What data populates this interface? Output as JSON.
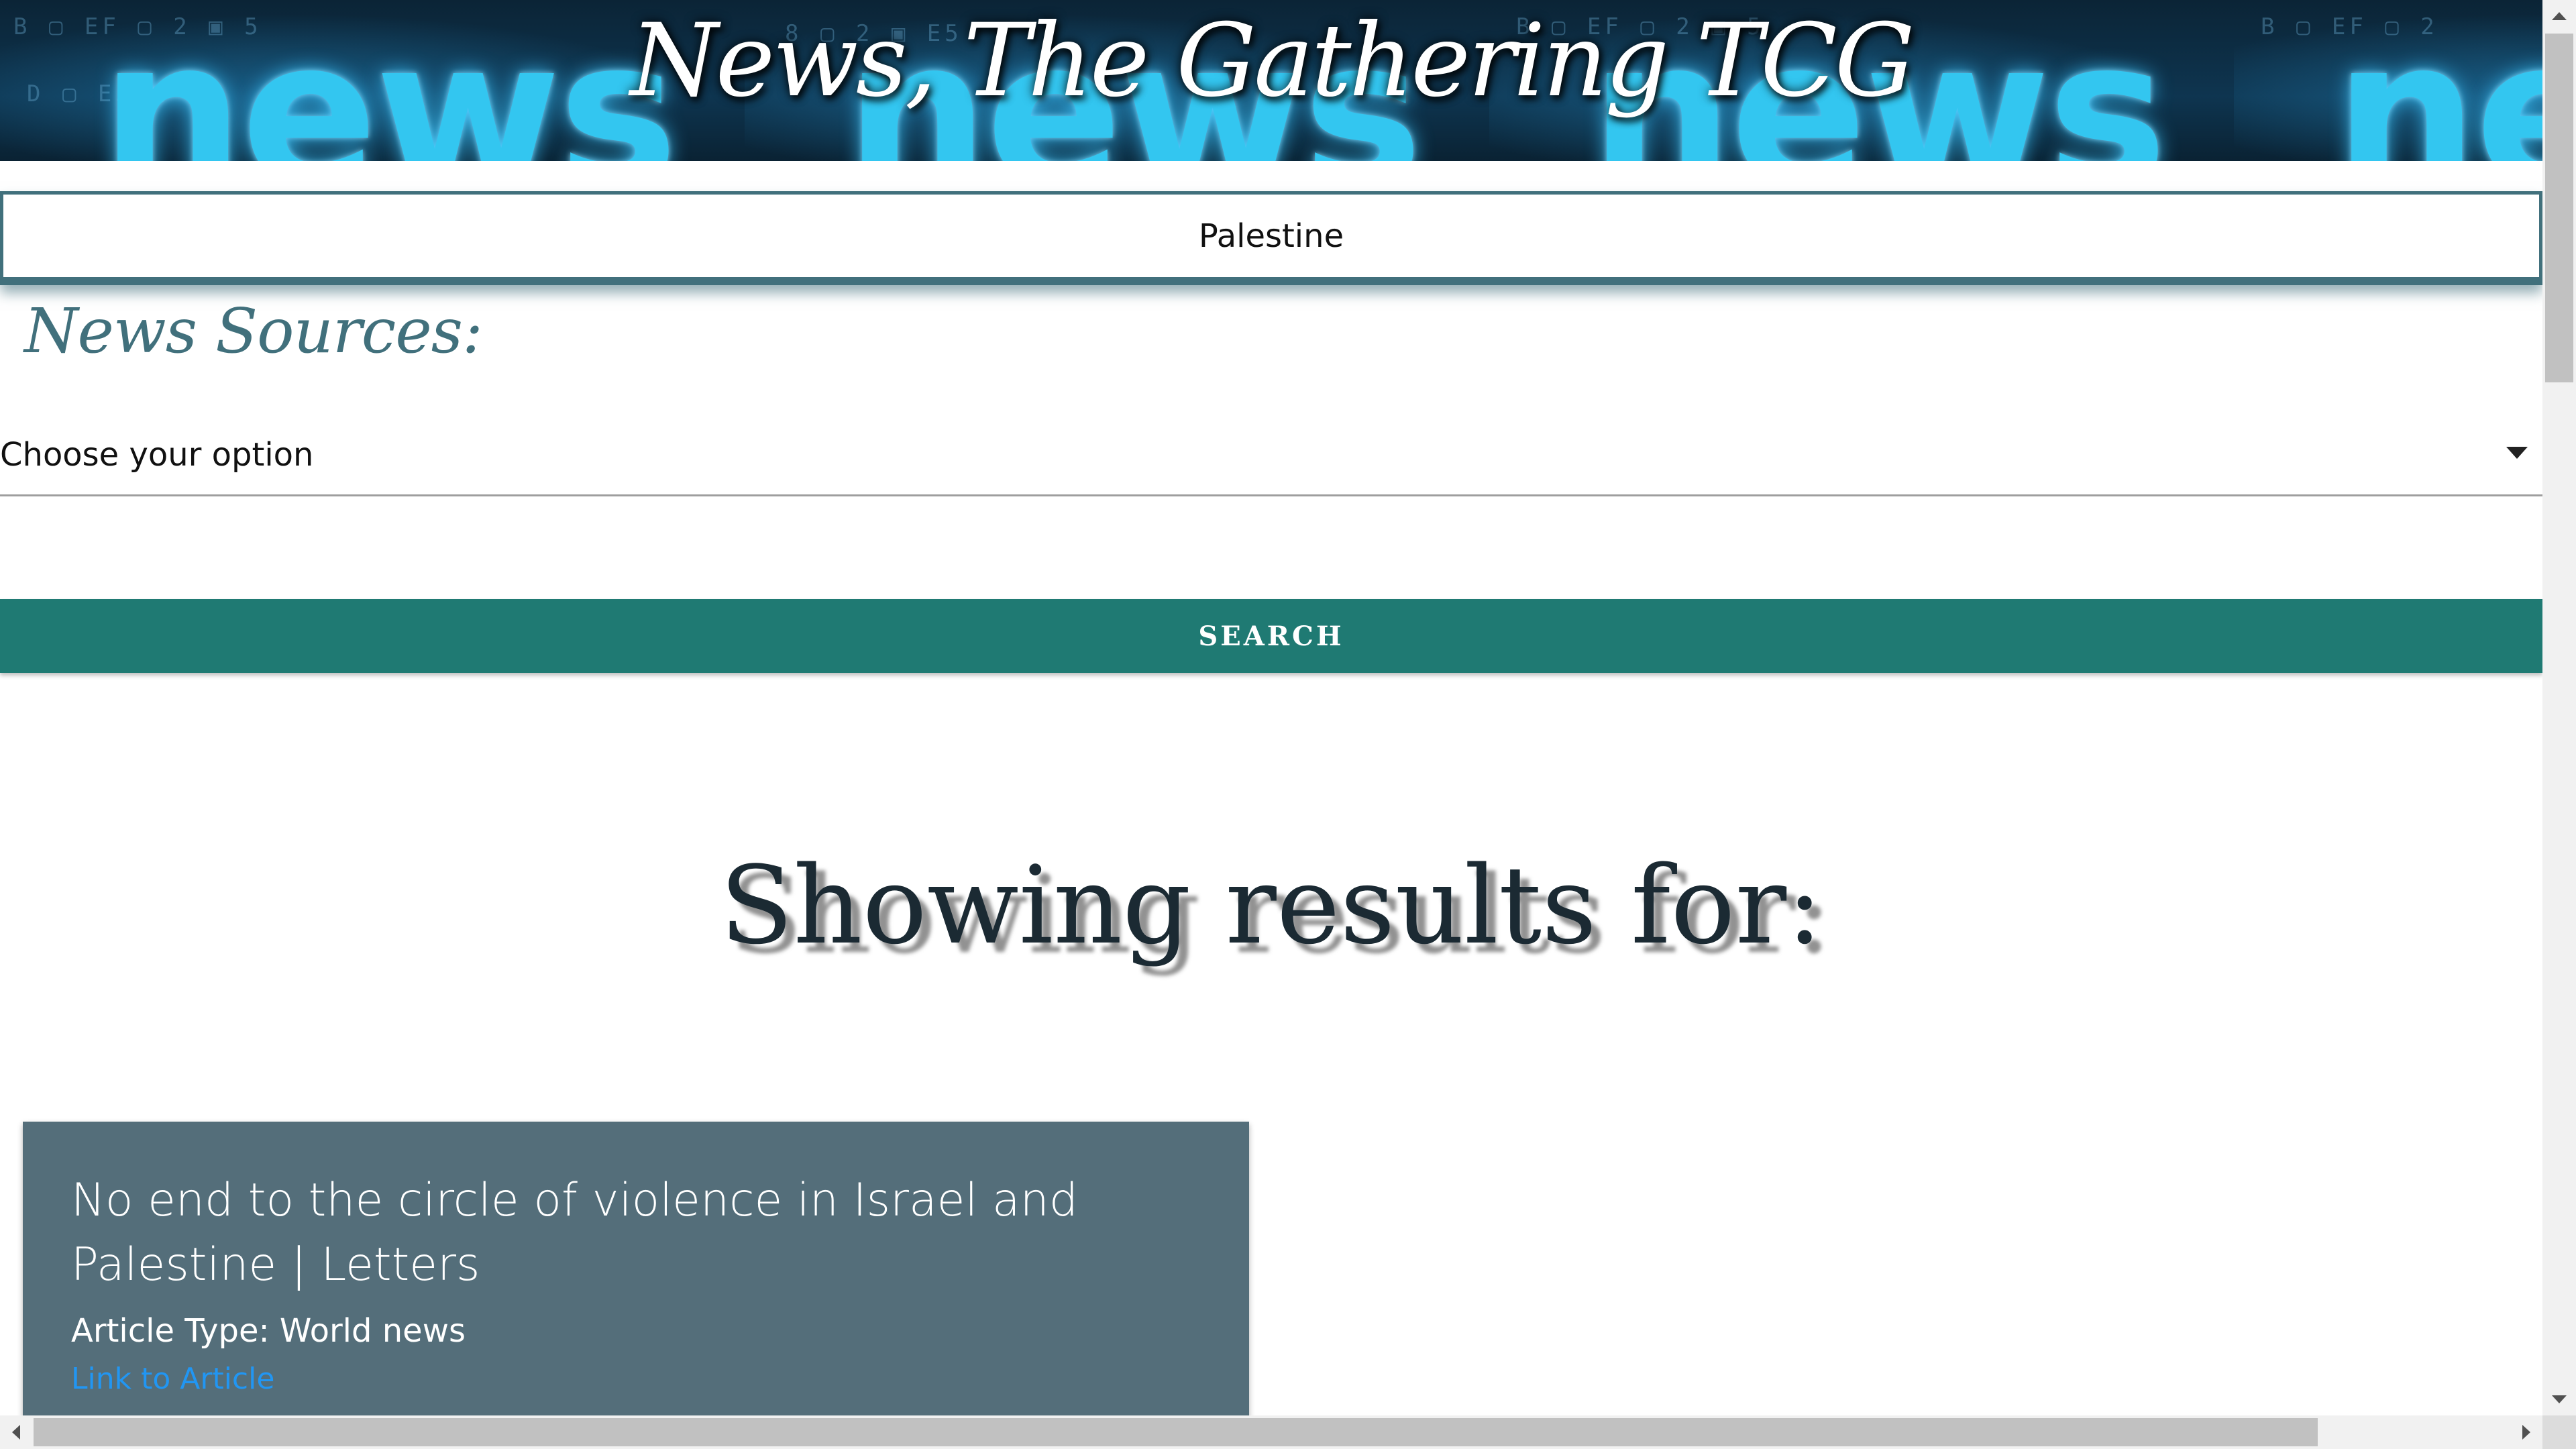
{
  "header": {
    "banner_word": "news",
    "title": "News, The Gathering TCG"
  },
  "search": {
    "value": "Palestine"
  },
  "sources": {
    "label": "News Sources:",
    "selected": "Choose your option"
  },
  "search_button": {
    "label": "SEARCH"
  },
  "results": {
    "heading": "Showing results for:",
    "articles": [
      {
        "title": "No end to the circle of violence in Israel and Palestine | Letters",
        "type": "Article Type: World news",
        "link_label": "Link to Article"
      }
    ]
  },
  "colors": {
    "accent": "#1f7a73",
    "card": "#546e7a",
    "border": "#41707c",
    "link": "#2196f3"
  },
  "icons": [
    "dropdown-caret-icon",
    "scroll-up-arrow-icon",
    "scroll-down-arrow-icon",
    "scroll-left-arrow-icon",
    "scroll-right-arrow-icon"
  ]
}
